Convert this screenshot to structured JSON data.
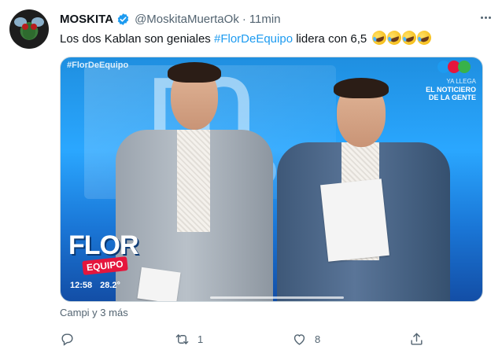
{
  "tweet": {
    "author_name": "MOSKITA",
    "author_handle": "@MoskitaMuertaOk",
    "separator": "·",
    "timestamp": "11min",
    "text_before": "Los dos Kablan son geniales ",
    "hashtag": "#FlorDeEquipo",
    "text_after": " lidera con 6,5",
    "emoji": "rolling-on-floor-laughing x4",
    "liked_by": "Campi y 3 más",
    "reply_count": "",
    "retweet_count": "1",
    "like_count": "8"
  },
  "media": {
    "overlay_hashtag": "#FlorDeEquipo",
    "news_line1": "YA LLEGA",
    "news_line2": "EL NOTICIERO",
    "news_line3": "DE LA GENTE",
    "show_logo_main": "FLOR",
    "show_logo_badge": "EQUIPO",
    "clock_time": "12:58",
    "clock_temp": "28.2°"
  },
  "colors": {
    "accent": "#1d9bf0",
    "secondary_text": "#536471",
    "primary_text": "#0f1419"
  },
  "icons": [
    "verified-badge-icon",
    "more-options-icon",
    "reply-icon",
    "retweet-icon",
    "like-icon",
    "share-icon"
  ]
}
